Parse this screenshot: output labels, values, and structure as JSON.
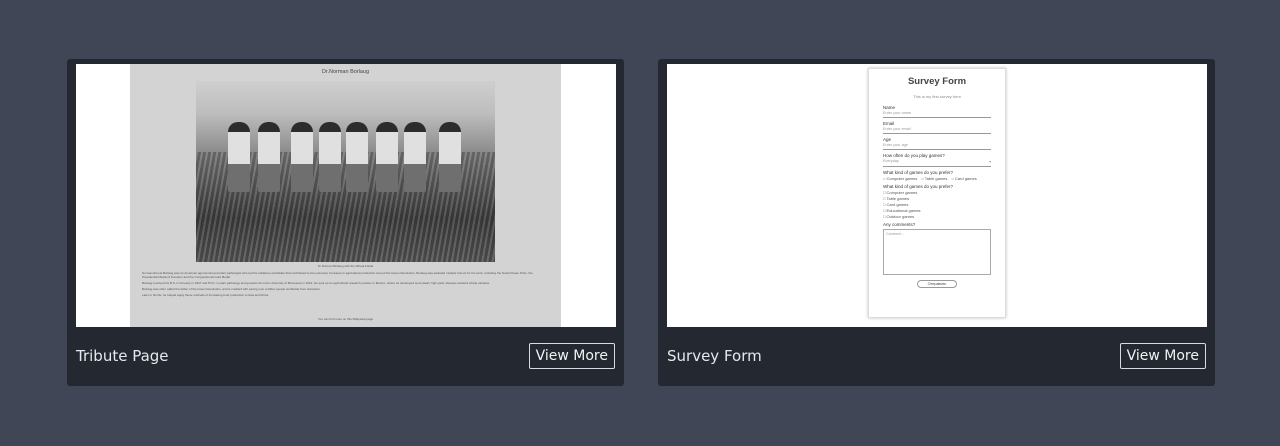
{
  "projects": [
    {
      "title": "Tribute Page",
      "button_label": "View More",
      "preview": {
        "heading": "Dr.Norman Borlaug",
        "caption": "Dr Norman Borlaug with the Wheat Fields",
        "paragraphs": [
          "Norman Ernest Borlaug was an American agronomist and plant pathologist who led the initiatives worldwide that contributed to the extensive increases in agricultural production termed the Green Revolution. Borlaug was awarded multiple honors for his work, including the Nobel Peace Prize, the Presidential Medal of Freedom and the Congressional Gold Medal.",
          "Borlaug received his B.S. in Forestry in 1937 and Ph.D. in plant pathology and genetics from the University of Minnesota in 1942. He took up an agricultural research position in Mexico, where he developed semi-dwarf, high-yield, disease-resistant wheat varieties.",
          "Borlaug was often called the father of the Green Revolution, and is credited with saving over a billion people worldwide from starvation.",
          "Later in his life, he helped apply these methods of increasing food production to Asia and Africa."
        ],
        "footer_text": "You can find more on this Wikipedia page"
      }
    },
    {
      "title": "Survey Form",
      "button_label": "View More",
      "preview": {
        "heading": "Survey Form",
        "description": "This is my first survey form",
        "fields": [
          {
            "label": "Name",
            "placeholder": "Enter your name"
          },
          {
            "label": "Email",
            "placeholder": "Enter your email"
          },
          {
            "label": "Age",
            "placeholder": "Enter your age"
          }
        ],
        "select_label": "How often do you play games?",
        "select_value": "Everyday",
        "radio_label": "What kind of games do you prefer?",
        "radio_options": [
          "Computer games",
          "Table games",
          "Card games"
        ],
        "checkbox_label": "What kind of games do you prefer?",
        "checkbox_options": [
          "Computer games",
          "Table games",
          "Card games",
          "Educational games",
          "Outdoor games"
        ],
        "comments_label": "Any comments?",
        "comments_placeholder": "Comment...",
        "submit_label": "Отправить"
      }
    }
  ]
}
